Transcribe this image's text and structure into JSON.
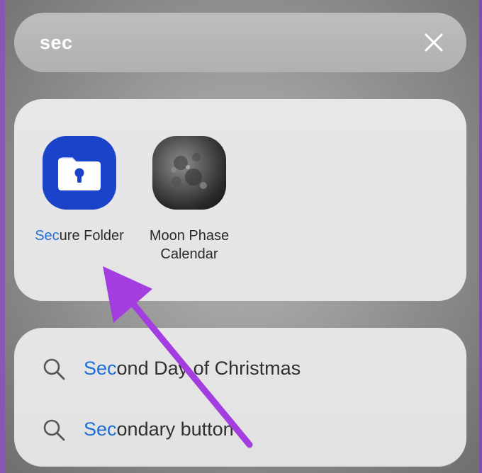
{
  "search": {
    "query": "sec",
    "clear_icon": "close-icon"
  },
  "apps": [
    {
      "label_highlight": "Sec",
      "label_rest": "ure Folder",
      "icon": "secure-folder-icon",
      "icon_color": "#1b43c9"
    },
    {
      "label_line1": "Moon Phase",
      "label_line2": "Calendar",
      "icon": "moon-icon"
    }
  ],
  "suggestions": [
    {
      "highlight": "Sec",
      "rest": "ond Day of Christmas",
      "icon": "search-icon"
    },
    {
      "highlight": "Sec",
      "rest": "ondary button",
      "icon": "search-icon"
    }
  ],
  "colors": {
    "highlight": "#1e6fd8",
    "annotation_arrow": "#a43de0"
  }
}
